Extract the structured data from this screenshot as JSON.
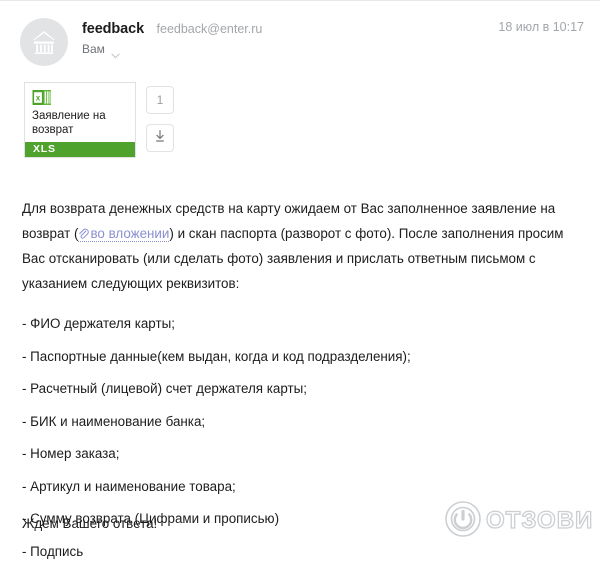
{
  "message": {
    "sender_name": "feedback",
    "sender_email": "feedback@enter.ru",
    "recipient_label": "Вам",
    "date": "18 июл в 10:17",
    "avatar_icon": "shopping-basket-icon",
    "chevron_icon": "chevron-down-icon"
  },
  "attachment": {
    "file_name": "Заявление на возврат",
    "extension": "XLS",
    "file_type_icon": "excel-file-icon",
    "count": "1",
    "download_icon": "download-arrow-icon",
    "badge_color": "#4fa32c"
  },
  "body": {
    "paragraph_part1": "Для возврата денежных средств на карту ожидаем от Вас заполненное заявление на возврат (",
    "link_text": "во вложении",
    "link_icon": "paperclip-icon",
    "link_color": "#8a8fd0",
    "paragraph_part2": ") и скан паспорта (разворот с фото). После заполнения просим Вас отсканировать (или сделать фото) заявления и прислать ответным письмом с указанием следующих реквизитов:",
    "requirements": [
      "- ФИО держателя карты;",
      "- Паспортные данные(кем выдан, когда и код подразделения);",
      "- Расчетный (лицевой) счет держателя карты;",
      "- БИК и наименование банка;",
      "- Номер заказа;",
      "- Артикул и наименование товара;",
      "- Сумму возврата (Цифрами и прописью)",
      "- Подпись"
    ],
    "closing": "Ждем Вашего ответа!"
  },
  "watermark": {
    "text": "ОТЗОВИК",
    "icon": "power-button-logo-icon"
  }
}
